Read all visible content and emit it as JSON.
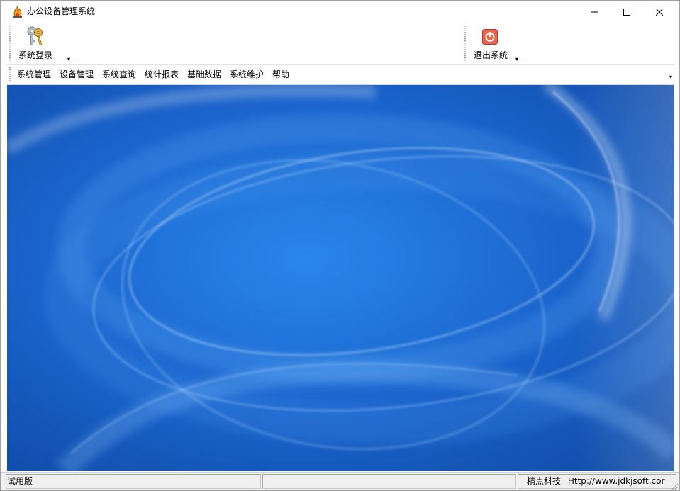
{
  "window": {
    "title": "办公设备管理系统",
    "app_icon": "flame-app-icon",
    "controls": {
      "minimize_icon": "minimize-icon",
      "maximize_icon": "maximize-icon",
      "close_icon": "close-icon"
    }
  },
  "toolbar": {
    "items": [
      {
        "label": "系统登录",
        "icon": "login-keys-icon",
        "has_dropdown": true
      },
      {
        "label": "退出系统",
        "icon": "power-exit-icon",
        "has_dropdown": true
      }
    ]
  },
  "menubar": {
    "items": [
      {
        "label": "系统管理"
      },
      {
        "label": "设备管理"
      },
      {
        "label": "系统查询"
      },
      {
        "label": "统计报表"
      },
      {
        "label": "基础数据"
      },
      {
        "label": "系统维护"
      },
      {
        "label": "帮助"
      }
    ],
    "overflow_icon": "chevron-down-icon"
  },
  "workspace": {
    "background": "blue-swirl-wallpaper",
    "colors": {
      "base": "#1a5fc6",
      "light": "#4aa0f0",
      "dark": "#0f3f98"
    }
  },
  "statusbar": {
    "edition": "试用版",
    "middle": "",
    "company": "精点科技",
    "url": "Http://www.jdkjsoft.cor"
  }
}
